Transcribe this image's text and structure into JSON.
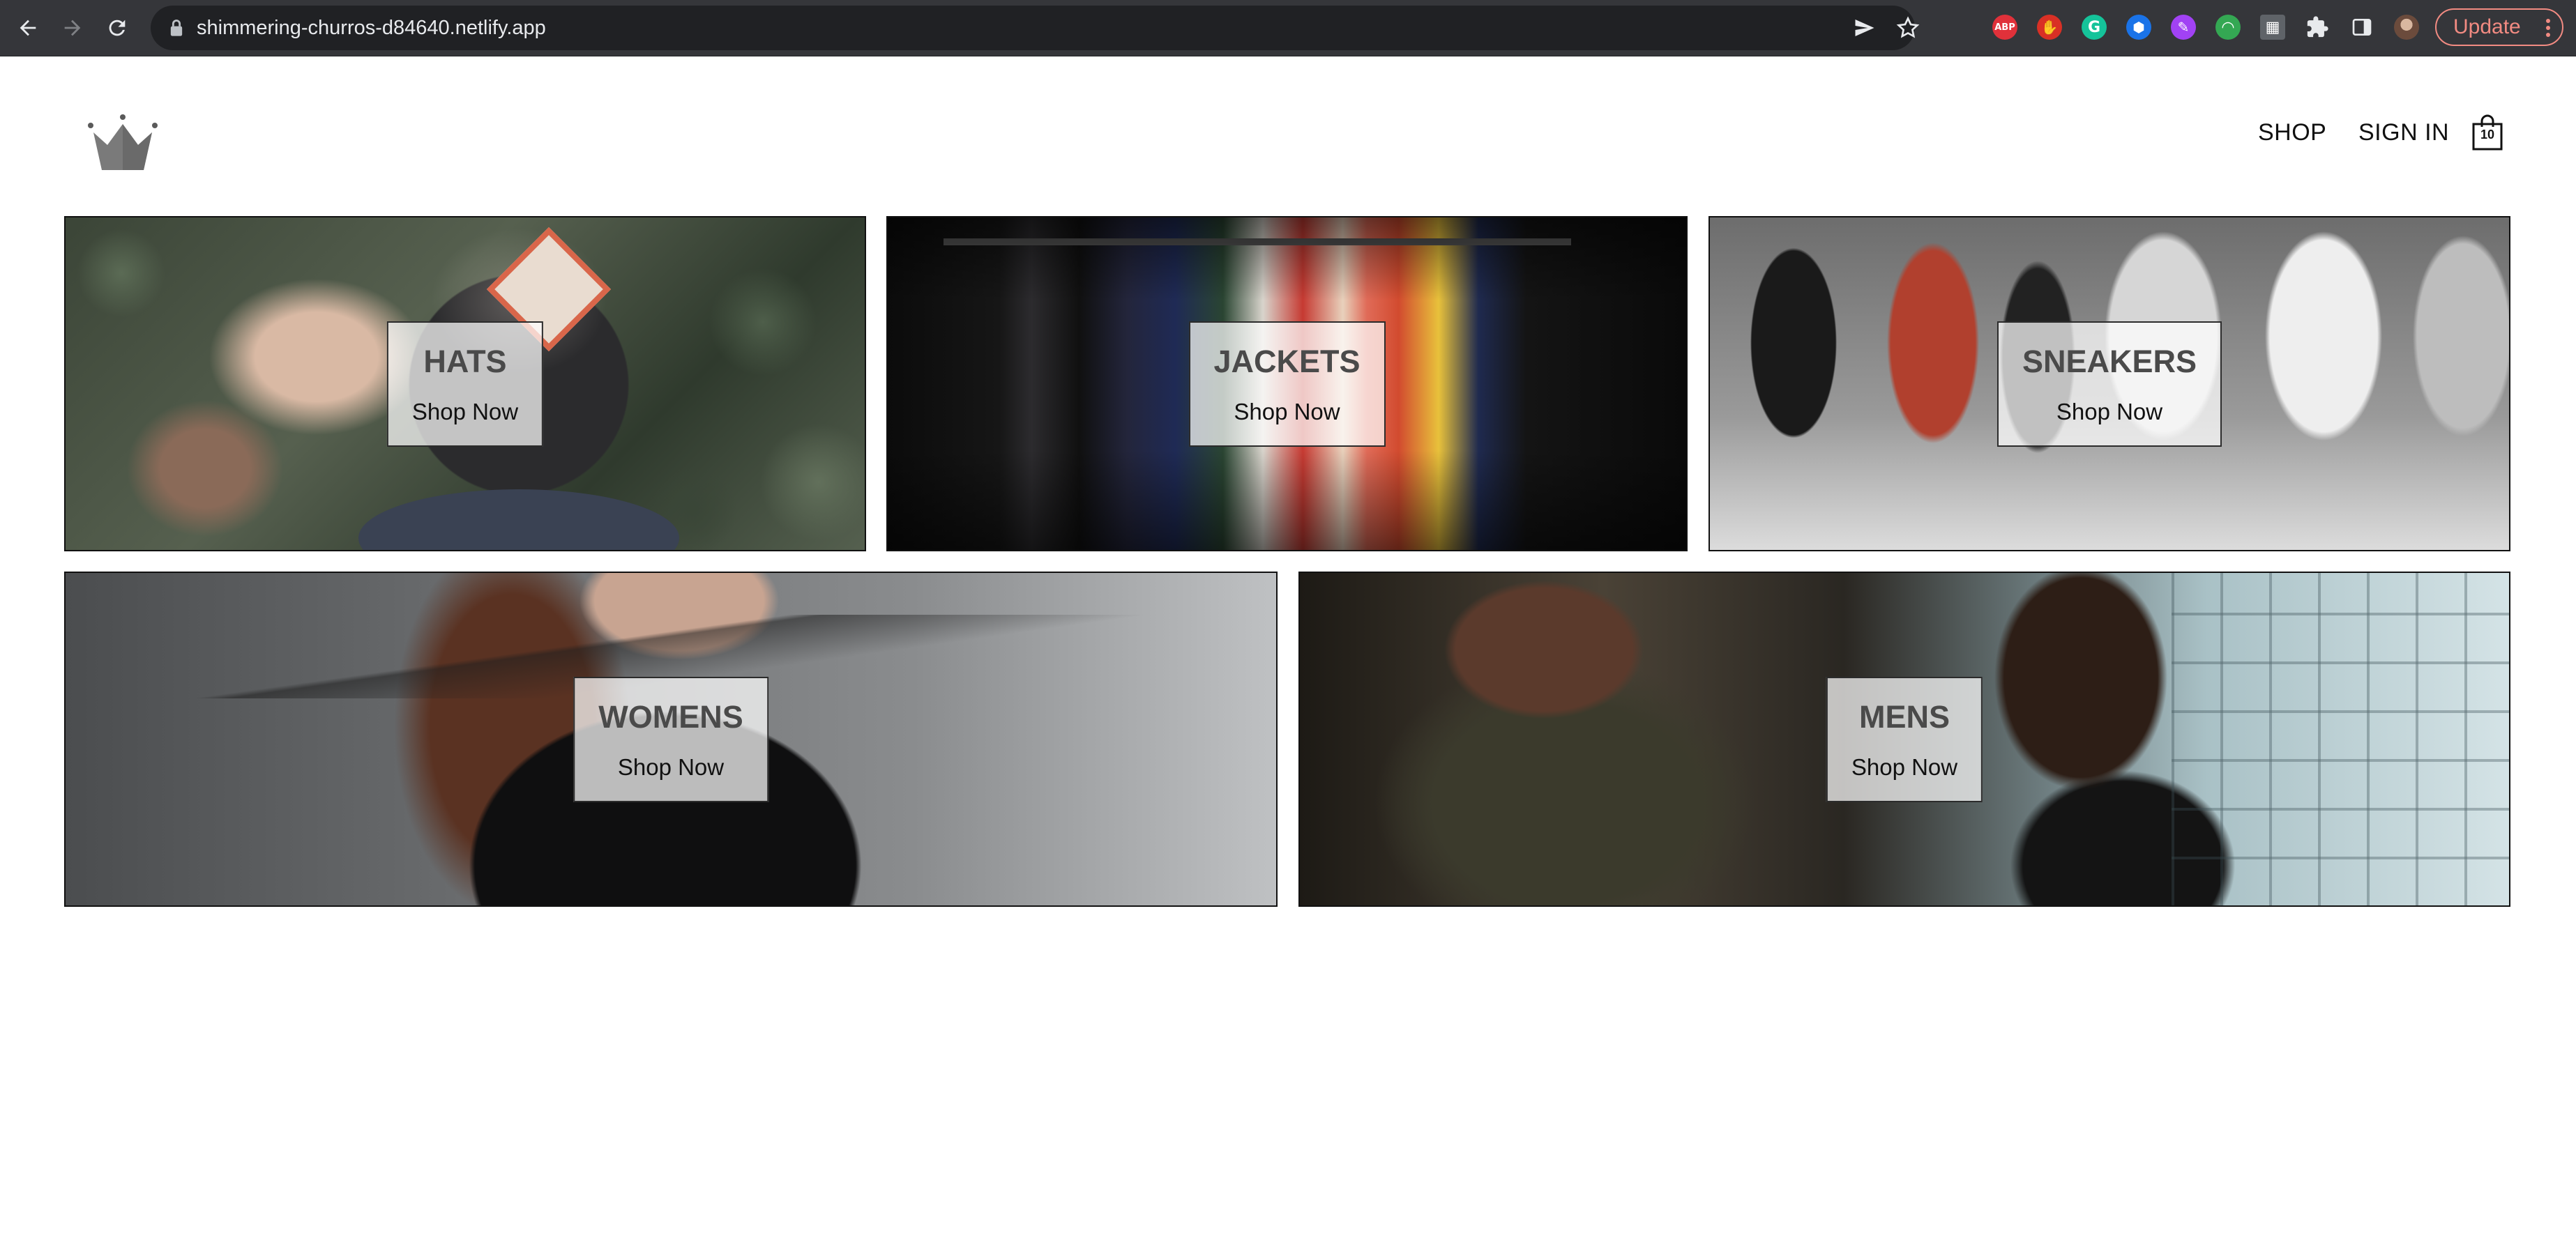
{
  "browser": {
    "url": "shimmering-churros-d84640.netlify.app",
    "update_label": "Update",
    "extensions": [
      {
        "name": "abp",
        "label": "ABP",
        "color": "#e0313a"
      },
      {
        "name": "hand",
        "label": "✋",
        "color": "#d93025"
      },
      {
        "name": "grammarly",
        "label": "G",
        "color": "#15c39a"
      },
      {
        "name": "shield",
        "label": "⬢",
        "color": "#1a73e8"
      },
      {
        "name": "quill",
        "label": "✎",
        "color": "#a142f4"
      },
      {
        "name": "rainbow",
        "label": "◠",
        "color": "#34a853"
      },
      {
        "name": "calendar",
        "label": "▦",
        "color": "#5f6368"
      }
    ]
  },
  "header": {
    "logo_icon": "crown-icon",
    "nav": {
      "shop_label": "SHOP",
      "signin_label": "SIGN IN"
    },
    "cart": {
      "icon": "shopping-bag-icon",
      "count": "10"
    }
  },
  "categories": [
    {
      "id": "hats",
      "title": "HATS",
      "subtitle": "Shop Now"
    },
    {
      "id": "jackets",
      "title": "JACKETS",
      "subtitle": "Shop Now"
    },
    {
      "id": "sneakers",
      "title": "SNEAKERS",
      "subtitle": "Shop Now"
    },
    {
      "id": "womens",
      "title": "WOMENS",
      "subtitle": "Shop Now"
    },
    {
      "id": "mens",
      "title": "MENS",
      "subtitle": "Shop Now"
    }
  ]
}
